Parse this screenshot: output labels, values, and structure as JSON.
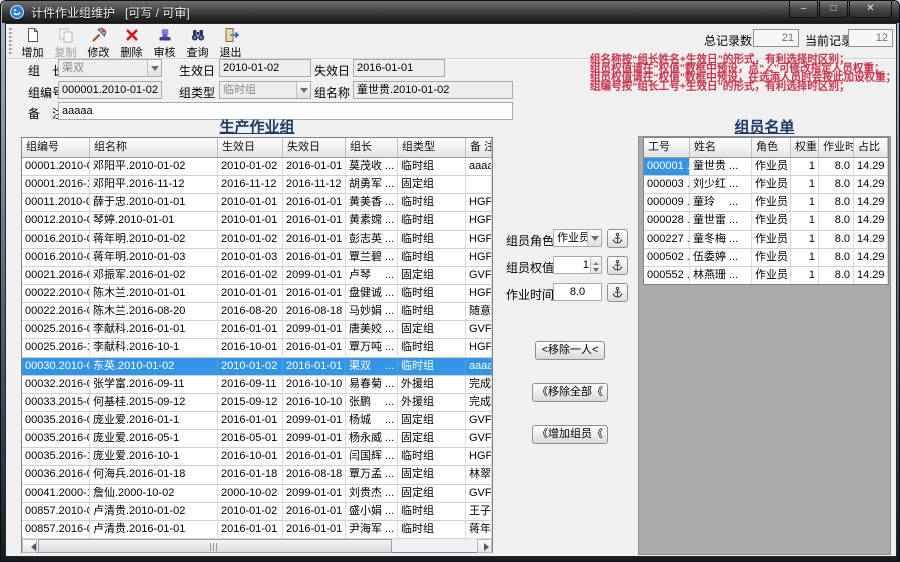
{
  "window": {
    "title": "计件作业组维护",
    "status": "[可写 / 可审]",
    "minimize_glyph": "–",
    "maximize_glyph": "□",
    "close_glyph": "✕"
  },
  "toolbar": {
    "items": [
      {
        "label": "增加",
        "icon": "new-doc-icon",
        "enabled": true
      },
      {
        "label": "复制",
        "icon": "copy-icon",
        "enabled": false
      },
      {
        "label": "修改",
        "icon": "edit-icon",
        "enabled": true
      },
      {
        "label": "删除",
        "icon": "delete-icon",
        "enabled": true
      },
      {
        "label": "审核",
        "icon": "audit-stamp-icon",
        "enabled": true
      },
      {
        "label": "查询",
        "icon": "binoculars-icon",
        "enabled": true
      },
      {
        "label": "退出",
        "icon": "exit-door-icon",
        "enabled": true
      }
    ]
  },
  "counters": {
    "total_label": "总记录数",
    "total_value": "21",
    "current_label": "当前记录",
    "current_value": "12"
  },
  "notes": {
    "color": "#c9344e",
    "lines": [
      "组名称按“组长姓名+生效日”的形式，有利选择时区别；",
      "组员权值请在“权值”数框中预设，点“∠”可修改指定人员权重；",
      "组员权值请在“权值”数框中预设，在选添人员时会按此加设权重；",
      "组编号按“组长工号+生效日”的形式，有利选择时区别；"
    ]
  },
  "form": {
    "leader_label": "组　长",
    "leader_value": "渠双",
    "effective_label": "生效日",
    "effective_value": "2010-01-02",
    "expire_label": "失效日",
    "expire_value": "2016-01-01",
    "group_no_label": "组编号",
    "group_no_value": "000001.2010-01-02",
    "group_type_label": "组类型",
    "group_type_value": "临时组",
    "group_name_label": "组名称",
    "group_name_value": "童世贵.2010-01-02",
    "remark_label": "备　注",
    "remark_value": "aaaaa"
  },
  "panels": {
    "left_title": "生产作业组",
    "right_title": "组员名单"
  },
  "left_table": {
    "columns": [
      "组编号",
      "组名称",
      "生效日",
      "失效日",
      "组长",
      "组类型",
      "备  注"
    ],
    "selected_index": 11,
    "rows": [
      [
        "00001.2010-0...",
        "邓阳平.2010-01-02",
        "2010-01-02",
        "2016-01-01",
        "莫茂收 ...",
        "临时组",
        "aaaaa"
      ],
      [
        "00001.2016-1...",
        "邓阳平.2016-11-12",
        "2016-11-12",
        "2016-11-12",
        "胡勇军 ...",
        "固定组",
        ""
      ],
      [
        "00011.2010-0...",
        "薛于忠.2010-01-01",
        "2010-01-01",
        "2016-01-01",
        "黄美香 ...",
        "临时组",
        "HGFHFG"
      ],
      [
        "00012.2010-0...",
        "琴婷.2010-01-01",
        "2010-01-01",
        "2016-01-01",
        "黄素嫦 ...",
        "临时组",
        "HGFHFG"
      ],
      [
        "00016.2010-0...",
        "蒋年明.2010-01-02",
        "2010-01-02",
        "2016-01-01",
        "彭志英 ...",
        "临时组",
        "HGFHFG"
      ],
      [
        "00016.2010-0...",
        "蒋年明.2010-01-03",
        "2010-01-03",
        "2016-01-01",
        "覃兰碧 ...",
        "临时组",
        "HGFHFG"
      ],
      [
        "00021.2016-0...",
        "邓振军.2016-01-02",
        "2016-01-02",
        "2099-01-01",
        "卢琴　 ...",
        "固定组",
        "GVFDGF"
      ],
      [
        "00022.2010-0...",
        "陈木兰.2010-01-01",
        "2010-01-01",
        "2016-01-01",
        "盘健诚 ...",
        "临时组",
        "HGFHFG"
      ],
      [
        "00022.2016-0...",
        "陈木兰.2016-08-20",
        "2016-08-20",
        "2016-08-18",
        "马妙娟 ...",
        "临时组",
        "随意"
      ],
      [
        "00025.2016-0...",
        "李献科.2016-01-01",
        "2016-01-01",
        "2099-01-01",
        "唐美姣 ...",
        "固定组",
        "GVFDGF"
      ],
      [
        "00025.2016-10-1",
        "李献科.2016-10-1",
        "2016-10-01",
        "2016-01-01",
        "覃万吨 ...",
        "临时组",
        "HGFHFG"
      ],
      [
        "00030.2010-0...",
        "东英.2010-01-02",
        "2010-01-02",
        "2016-01-01",
        "渠双　 ...",
        "临时组",
        "aaaaa"
      ],
      [
        "00032.2016-0...",
        "张学富.2016-09-11",
        "2016-09-11",
        "2016-10-10",
        "易春菊 ...",
        "外援组",
        "完成工"
      ],
      [
        "00033.2015-0...",
        "何基桂.2015-09-12",
        "2015-09-12",
        "2016-10-10",
        "张鹏　 ...",
        "外援组",
        "完成工"
      ],
      [
        "00035.2016-01-1",
        "庞业爱.2016-01-1",
        "2016-01-01",
        "2099-01-01",
        "杨城　 ...",
        "固定组",
        "GVFDGF"
      ],
      [
        "00035.2016-05-1",
        "庞业爱.2016-05-1",
        "2016-05-01",
        "2099-01-01",
        "杨永威 ...",
        "固定组",
        "GVFDGF"
      ],
      [
        "00035.2016-10-1",
        "庞业爱.2016-10-1",
        "2016-10-01",
        "2016-01-01",
        "闫国辉 ...",
        "临时组",
        "HGFHFG"
      ],
      [
        "00036.2016-0...",
        "何海兵.2016-01-18",
        "2016-01-18",
        "2016-08-18",
        "覃万孟 ...",
        "固定组",
        "林翠叶"
      ],
      [
        "00041.2000-1...",
        "詹仙.2000-10-02",
        "2000-10-02",
        "2099-01-01",
        "刘贵杰 ...",
        "固定组",
        "GVFDGF"
      ],
      [
        "00857.2010-0...",
        "卢清贵.2010-01-02",
        "2010-01-02",
        "2016-01-01",
        "盛小娟 ...",
        "临时组",
        "王子山"
      ],
      [
        "00857.2016-0...",
        "卢清贵.2016-01-01",
        "2016-01-01",
        "2016-01-01",
        "尹海军 ...",
        "临时组",
        "蒋年明"
      ]
    ]
  },
  "right_table": {
    "columns": [
      "工号",
      "姓名",
      "角色",
      "权重",
      "作业时",
      "占比"
    ],
    "selected_cell": [
      0,
      0
    ],
    "rows": [
      [
        "000001 ...",
        "童世贵 ...",
        "作业员",
        "1",
        "8.0",
        "14.29"
      ],
      [
        "000003 ...",
        "刘少红 ...",
        "作业员",
        "1",
        "8.0",
        "14.29"
      ],
      [
        "000009 ...",
        "童玲　 ...",
        "作业员",
        "1",
        "8.0",
        "14.29"
      ],
      [
        "000028 ...",
        "童世雷 ...",
        "作业员",
        "1",
        "8.0",
        "14.29"
      ],
      [
        "000227 ...",
        "童冬梅 ...",
        "作业员",
        "1",
        "8.0",
        "14.29"
      ],
      [
        "000502 ...",
        "伍委婷 ...",
        "作业员",
        "1",
        "8.0",
        "14.29"
      ],
      [
        "000552 ...",
        "林燕珊 ...",
        "作业员",
        "1",
        "8.0",
        "14.29"
      ]
    ]
  },
  "member_controls": {
    "role_label": "组员角色",
    "role_value": "作业员",
    "weight_label": "组员权值",
    "weight_value": "1",
    "time_label": "作业时间",
    "time_value": "8.0"
  },
  "transfer": {
    "remove_one": "<移除一人<",
    "remove_all": "《移除全部《",
    "add_members": "《增加组员《"
  },
  "colors": {
    "selection": "#3494e6",
    "note_red": "#c9344e",
    "panel_gray": "#ababab",
    "title_blue": "#1d3a68"
  }
}
